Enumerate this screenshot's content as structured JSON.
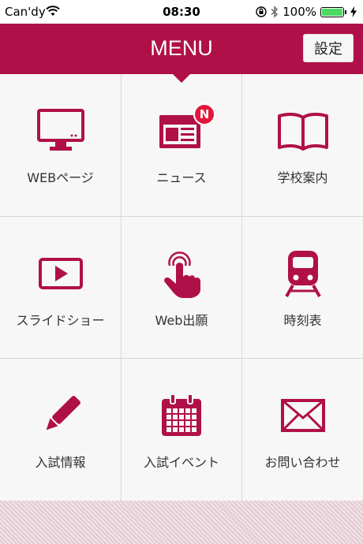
{
  "status_bar": {
    "carrier": "Can'dy",
    "time": "08:30",
    "battery": "100%",
    "battery_level": 1.0
  },
  "header": {
    "title": "MENU",
    "settings_label": "設定"
  },
  "colors": {
    "accent": "#b01048",
    "background": "#f7f7f7"
  },
  "menu": [
    {
      "label": "WEBページ",
      "icon": "monitor-icon"
    },
    {
      "label": "ニュース",
      "icon": "newspaper-icon",
      "badge": "N"
    },
    {
      "label": "学校案内",
      "icon": "book-icon"
    },
    {
      "label": "スライドショー",
      "icon": "play-video-icon"
    },
    {
      "label": "Web出願",
      "icon": "tap-hand-icon"
    },
    {
      "label": "時刻表",
      "icon": "train-icon"
    },
    {
      "label": "入試情報",
      "icon": "pencil-icon"
    },
    {
      "label": "入試イベント",
      "icon": "calendar-icon"
    },
    {
      "label": "お問い合わせ",
      "icon": "envelope-icon"
    }
  ]
}
